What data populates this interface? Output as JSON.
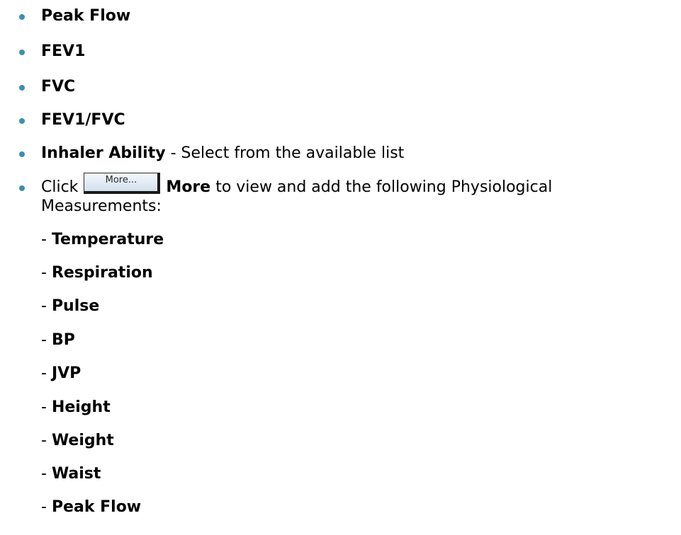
{
  "list": {
    "items": [
      {
        "bold": "Peak Flow",
        "rest": ""
      },
      {
        "bold": "FEV1",
        "rest": ""
      },
      {
        "bold": "FVC",
        "rest": ""
      },
      {
        "bold": "FEV1/FVC",
        "rest": ""
      },
      {
        "bold": "Inhaler Ability",
        "rest": " - Select from the available list"
      }
    ],
    "more_item": {
      "prefix": "Click",
      "button_label": "More...",
      "bold": "More",
      "rest_line1": " to view and add the following Physiological",
      "line2": "Measurements:"
    },
    "sub_items": [
      "Temperature",
      "Respiration",
      "Pulse",
      "BP",
      "JVP",
      "Height",
      "Weight",
      "Waist",
      "Peak Flow"
    ],
    "dash": "- "
  },
  "colors": {
    "bullet": "#3a8fb0"
  }
}
